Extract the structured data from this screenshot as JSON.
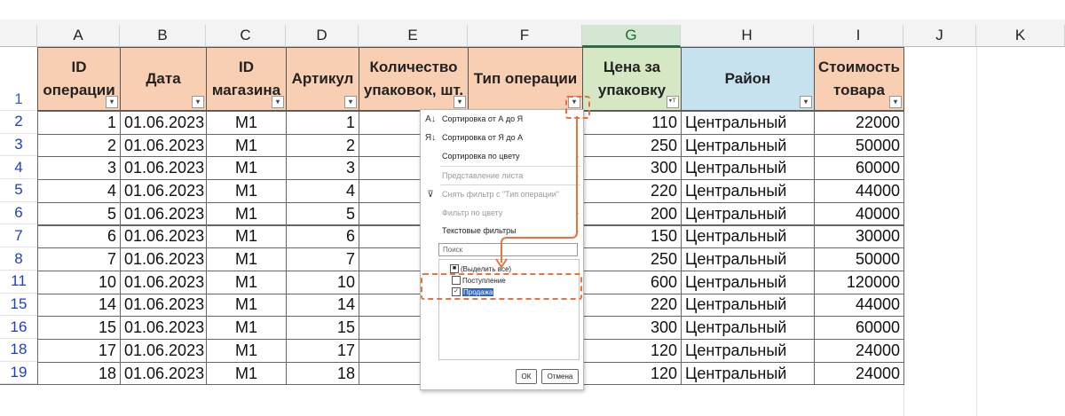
{
  "columns": [
    "A",
    "B",
    "C",
    "D",
    "E",
    "F",
    "G",
    "H",
    "I",
    "J",
    "K"
  ],
  "selected_column": "G",
  "header_row_number": "1",
  "headers": [
    "ID операции",
    "Дата",
    "ID магазина",
    "Артикул",
    "Количество упаковок, шт.",
    "Тип операции",
    "Цена за упаковку",
    "Район",
    "Стоимость товара"
  ],
  "rows": [
    {
      "n": "2",
      "id": "1",
      "date": "01.06.2023",
      "store": "М1",
      "art": "1",
      "price": "110",
      "district": "Центральный",
      "cost": "22000"
    },
    {
      "n": "3",
      "id": "2",
      "date": "01.06.2023",
      "store": "М1",
      "art": "2",
      "price": "250",
      "district": "Центральный",
      "cost": "50000"
    },
    {
      "n": "4",
      "id": "3",
      "date": "01.06.2023",
      "store": "М1",
      "art": "3",
      "price": "300",
      "district": "Центральный",
      "cost": "60000"
    },
    {
      "n": "5",
      "id": "4",
      "date": "01.06.2023",
      "store": "М1",
      "art": "4",
      "price": "220",
      "district": "Центральный",
      "cost": "44000"
    },
    {
      "n": "6",
      "id": "5",
      "date": "01.06.2023",
      "store": "М1",
      "art": "5",
      "price": "200",
      "district": "Центральный",
      "cost": "40000"
    },
    {
      "n": "7",
      "id": "6",
      "date": "01.06.2023",
      "store": "М1",
      "art": "6",
      "price": "150",
      "district": "Центральный",
      "cost": "30000"
    },
    {
      "n": "8",
      "id": "7",
      "date": "01.06.2023",
      "store": "М1",
      "art": "7",
      "price": "250",
      "district": "Центральный",
      "cost": "50000"
    },
    {
      "n": "11",
      "id": "10",
      "date": "01.06.2023",
      "store": "М1",
      "art": "10",
      "price": "600",
      "district": "Центральный",
      "cost": "120000"
    },
    {
      "n": "15",
      "id": "14",
      "date": "01.06.2023",
      "store": "М1",
      "art": "14",
      "price": "220",
      "district": "Центральный",
      "cost": "44000"
    },
    {
      "n": "16",
      "id": "15",
      "date": "01.06.2023",
      "store": "М1",
      "art": "15",
      "price": "300",
      "district": "Центральный",
      "cost": "60000"
    },
    {
      "n": "18",
      "id": "17",
      "date": "01.06.2023",
      "store": "М1",
      "art": "17",
      "price": "120",
      "district": "Центральный",
      "cost": "24000"
    },
    {
      "n": "19",
      "id": "18",
      "date": "01.06.2023",
      "store": "М1",
      "art": "18",
      "price": "120",
      "district": "Центральный",
      "cost": "24000"
    }
  ],
  "colors": {
    "header_orange": "#f9cfb4",
    "header_green": "#d6e8c3",
    "header_blue": "#c6e2ef",
    "accent": "#e9733f",
    "excel_green": "#217346",
    "row_number_blue": "#1f3fbf"
  },
  "filter_menu": {
    "sort_asc": "Сортировка от А до Я",
    "sort_desc": "Сортировка от Я до А",
    "sort_by_color": "Сортировка по цвету",
    "sheet_view": "Представление листа",
    "clear_filter": "Снять фильтр с \"Тип операции\"",
    "filter_by_color": "Фильтр по цвету",
    "text_filters": "Текстовые фильтры",
    "search_placeholder": "Поиск",
    "items": [
      {
        "label": "(Выделить все)",
        "state": "partial"
      },
      {
        "label": "Поступление",
        "state": "unchecked"
      },
      {
        "label": "Продажа",
        "state": "checked"
      }
    ],
    "ok": "ОК",
    "cancel": "Отмена"
  },
  "icons": {
    "sort_asc": "sort-az-icon",
    "sort_desc": "sort-za-icon",
    "clear_filter": "funnel-clear-icon",
    "filter_button": "dropdown-arrow-icon",
    "filter_active": "filter-funnel-icon"
  }
}
